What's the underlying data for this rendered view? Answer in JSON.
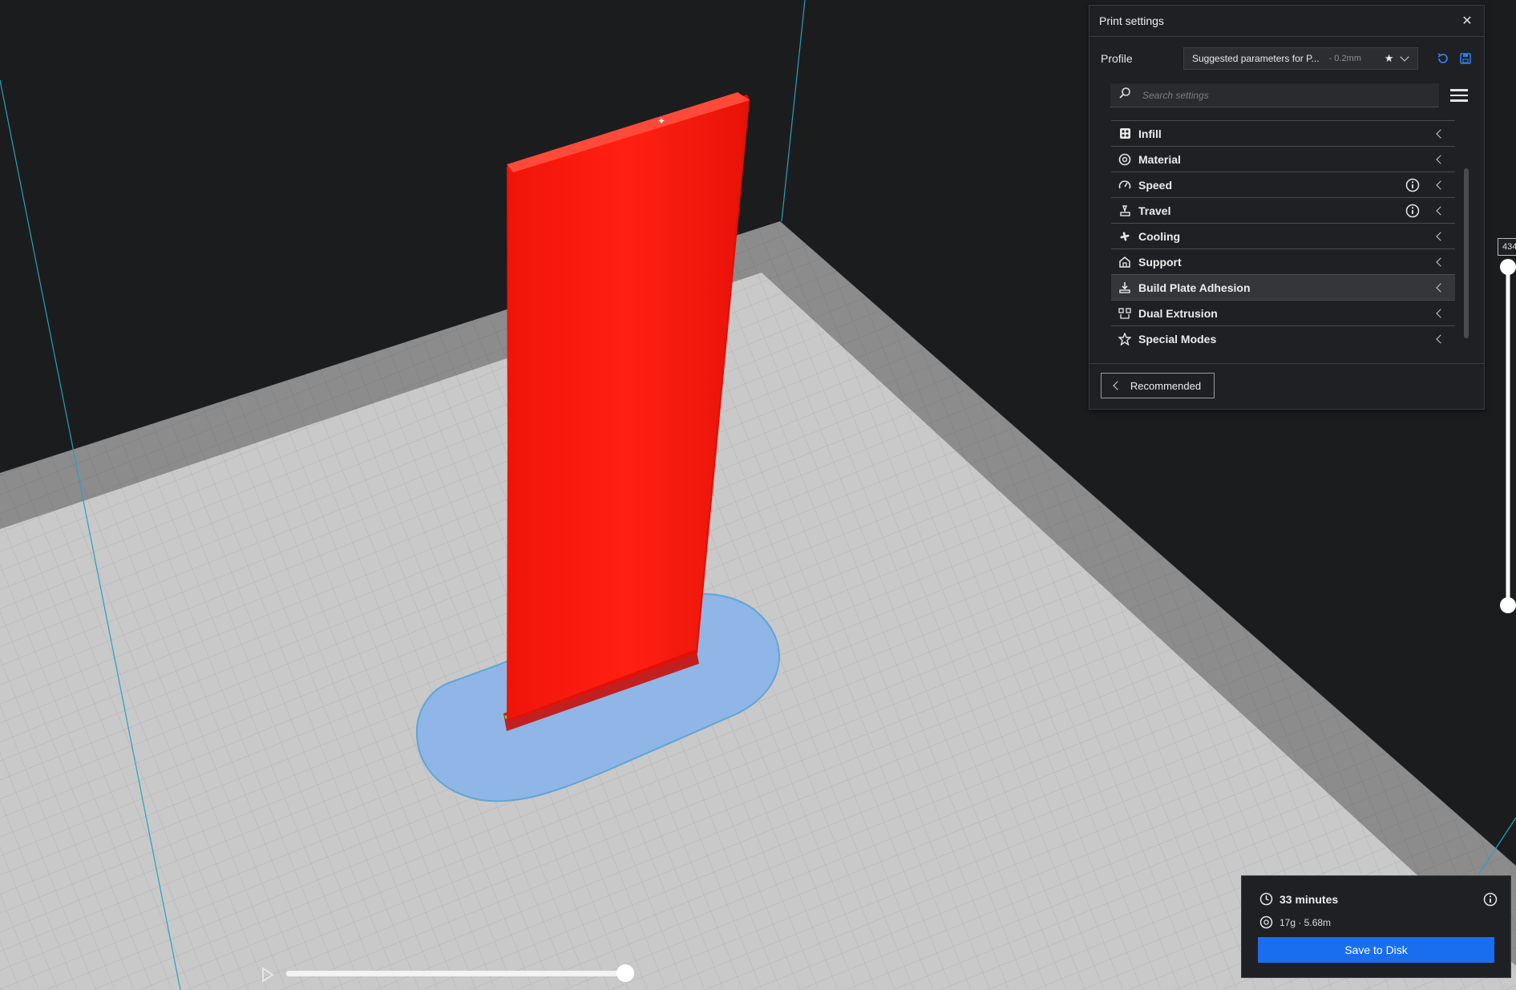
{
  "print_settings": {
    "title": "Print settings",
    "close_icon": "close-icon",
    "profile_label": "Profile",
    "profile_name": "Suggested parameters for P...",
    "profile_suffix": "- 0.2mm",
    "search_placeholder": "Search settings",
    "categories": [
      {
        "label": "Infill",
        "icon": "infill-icon",
        "info": false
      },
      {
        "label": "Material",
        "icon": "material-icon",
        "info": false
      },
      {
        "label": "Speed",
        "icon": "speed-icon",
        "info": true
      },
      {
        "label": "Travel",
        "icon": "travel-icon",
        "info": true
      },
      {
        "label": "Cooling",
        "icon": "cooling-icon",
        "info": false
      },
      {
        "label": "Support",
        "icon": "support-icon",
        "info": false
      },
      {
        "label": "Build Plate Adhesion",
        "icon": "adhesion-icon",
        "info": false
      },
      {
        "label": "Dual Extrusion",
        "icon": "dual-extrusion-icon",
        "info": false
      },
      {
        "label": "Special Modes",
        "icon": "star-icon",
        "info": false
      }
    ],
    "recommended_label": "Recommended"
  },
  "layer_slider": {
    "value": "434"
  },
  "estimate": {
    "time": "33 minutes",
    "material": "17g · 5.68m",
    "save_label": "Save to Disk"
  },
  "colors": {
    "accent": "#196ef0",
    "model": "#ff1a10",
    "brim": "#8fb6e6",
    "build_plate": "#c8c8c8",
    "background": "#1b1c1e"
  }
}
